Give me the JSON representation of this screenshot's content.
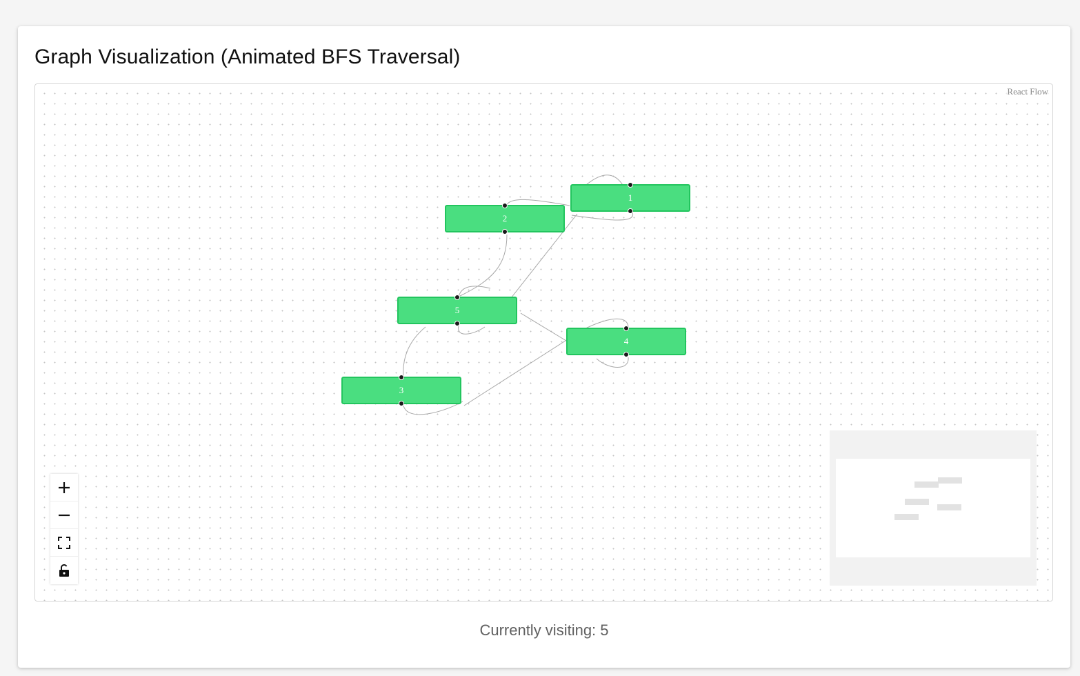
{
  "page": {
    "title": "Graph Visualization (Animated BFS Traversal)",
    "status_prefix": "Currently visiting: ",
    "current_node": "5"
  },
  "flow": {
    "attribution": "React Flow",
    "nodes": [
      {
        "id": "1",
        "label": "1"
      },
      {
        "id": "2",
        "label": "2"
      },
      {
        "id": "3",
        "label": "3"
      },
      {
        "id": "4",
        "label": "4"
      },
      {
        "id": "5",
        "label": "5"
      }
    ],
    "node_color": "#4ade80",
    "node_border_color": "#22c55e",
    "edge_color": "#a8a8a8"
  },
  "controls": [
    {
      "name": "zoom-in-button",
      "icon": "plus-icon"
    },
    {
      "name": "zoom-out-button",
      "icon": "minus-icon"
    },
    {
      "name": "fit-view-button",
      "icon": "fit-view-icon"
    },
    {
      "name": "toggle-interactivity-button",
      "icon": "unlock-icon"
    }
  ]
}
